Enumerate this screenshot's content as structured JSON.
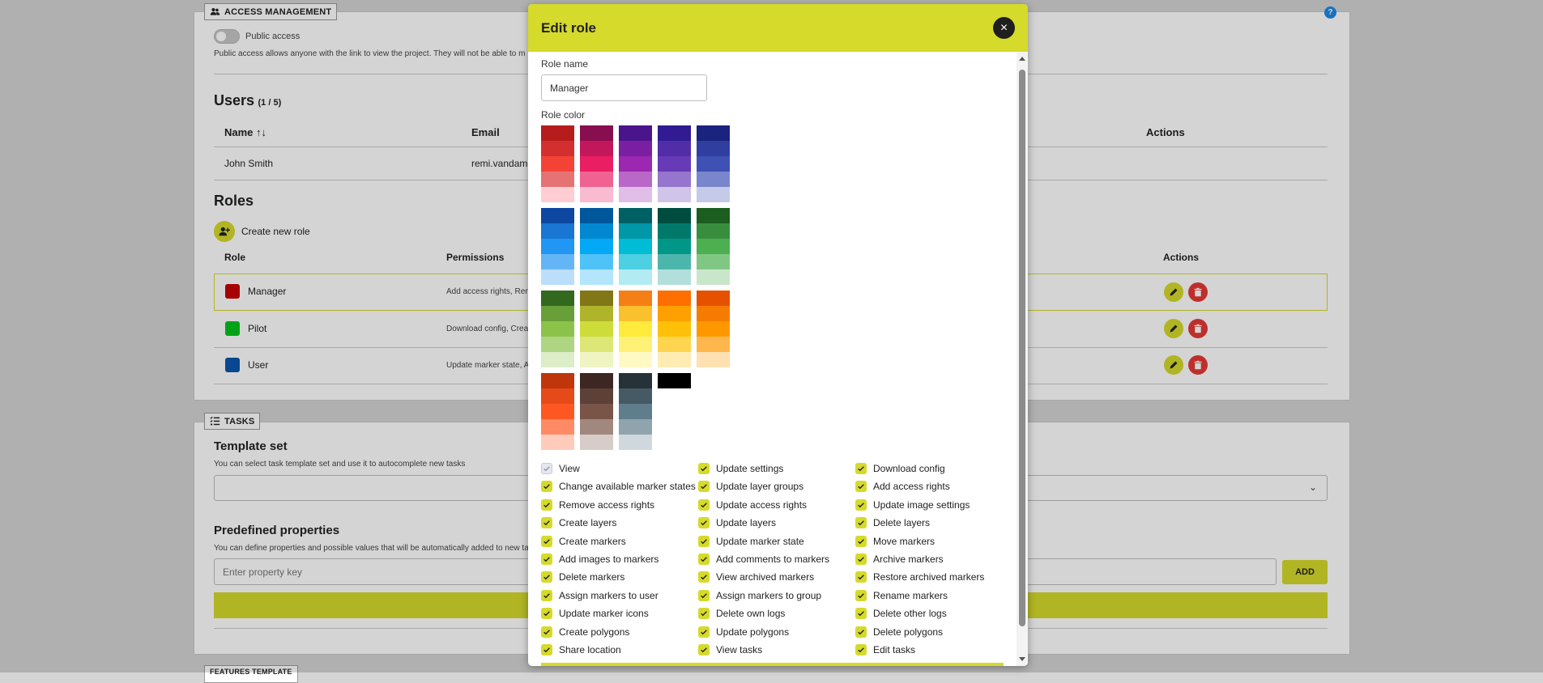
{
  "access": {
    "legend": "ACCESS MANAGEMENT",
    "public_label": "Public access",
    "public_desc": "Public access allows anyone with the link to view the project. They will not be able to m",
    "help": "?"
  },
  "users": {
    "title": "Users",
    "count": "(1 / 5)",
    "col_name": "Name",
    "col_email": "Email",
    "col_actions": "Actions",
    "rows": [
      {
        "name": "John Smith",
        "email": "remi.vandame"
      }
    ]
  },
  "roles": {
    "title": "Roles",
    "create": "Create new role",
    "col_role": "Role",
    "col_permissions": "Permissions",
    "col_actions": "Actions",
    "rows": [
      {
        "name": "Manager",
        "perms": "Add access rights, Remo",
        "color": "#c90000"
      },
      {
        "name": "Pilot",
        "perms": "Download config, Create",
        "color": "#00c31e"
      },
      {
        "name": "User",
        "perms": "Update marker state, Add",
        "color": "#0b56ae"
      }
    ]
  },
  "tasks": {
    "legend": "TASKS",
    "template_title": "Template set",
    "template_desc": "You can select task template set and use it to autocomplete new tasks",
    "predef_title": "Predefined properties",
    "predef_desc": "You can define properties and possible values that will be automatically added to new ta",
    "key_placeholder": "Enter property key",
    "add_label": "ADD"
  },
  "next_legend": "FEATURES TEMPLATE",
  "modal": {
    "title": "Edit role",
    "close": "×",
    "role_name_label": "Role name",
    "role_name_value": "Manager",
    "role_color_label": "Role color",
    "palette": [
      [
        "#b71c1c",
        "#d32f2f",
        "#f44336",
        "#e57373",
        "#ffcdd2"
      ],
      [
        "#880e4f",
        "#c2185b",
        "#e91e63",
        "#f06292",
        "#f8bbd0"
      ],
      [
        "#4a148c",
        "#7b1fa2",
        "#9c27b0",
        "#ba68c8",
        "#e1bee7"
      ],
      [
        "#311b92",
        "#512da8",
        "#673ab7",
        "#9575cd",
        "#d1c4e9"
      ],
      [
        "#1a237e",
        "#303f9f",
        "#3f51b5",
        "#7986cb",
        "#c5cae9"
      ],
      [
        "#0d47a1",
        "#1976d2",
        "#2196f3",
        "#64b5f6",
        "#bbdefb"
      ],
      [
        "#01579b",
        "#0288d1",
        "#03a9f4",
        "#4fc3f7",
        "#b3e5fc"
      ],
      [
        "#006064",
        "#0097a7",
        "#00bcd4",
        "#4dd0e1",
        "#b2ebf2"
      ],
      [
        "#004d40",
        "#00796b",
        "#009688",
        "#4db6ac",
        "#b2dfdb"
      ],
      [
        "#1b5e20",
        "#388e3c",
        "#4caf50",
        "#81c784",
        "#c8e6c9"
      ],
      [
        "#33691e",
        "#689f38",
        "#8bc34a",
        "#aed581",
        "#dcedc8"
      ],
      [
        "#827717",
        "#afb42b",
        "#cddc39",
        "#dce775",
        "#f0f4c3"
      ],
      [
        "#f57f17",
        "#fbc02d",
        "#ffeb3b",
        "#fff176",
        "#fff9c4"
      ],
      [
        "#ff6f00",
        "#ffa000",
        "#ffc107",
        "#ffd54f",
        "#ffecb3"
      ],
      [
        "#e65100",
        "#f57c00",
        "#ff9800",
        "#ffb74d",
        "#ffe0b2"
      ],
      [
        "#bf360c",
        "#e64a19",
        "#ff5722",
        "#ff8a65",
        "#ffccbc"
      ],
      [
        "#3e2723",
        "#5d4037",
        "#795548",
        "#a1887f",
        "#d7ccc8"
      ],
      [
        "#263238",
        "#455a64",
        "#607d8b",
        "#90a4ae",
        "#cfd8dc"
      ],
      [
        "#000000"
      ]
    ],
    "permissions": [
      {
        "label": "View",
        "disabled": true
      },
      {
        "label": "Update settings"
      },
      {
        "label": "Download config"
      },
      {
        "label": "Change available marker states"
      },
      {
        "label": "Update layer groups"
      },
      {
        "label": "Add access rights"
      },
      {
        "label": "Remove access rights"
      },
      {
        "label": "Update access rights"
      },
      {
        "label": "Update image settings"
      },
      {
        "label": "Create layers"
      },
      {
        "label": "Update layers"
      },
      {
        "label": "Delete layers"
      },
      {
        "label": "Create markers"
      },
      {
        "label": "Update marker state"
      },
      {
        "label": "Move markers"
      },
      {
        "label": "Add images to markers"
      },
      {
        "label": "Add comments to markers"
      },
      {
        "label": "Archive markers"
      },
      {
        "label": "Delete markers"
      },
      {
        "label": "View archived markers"
      },
      {
        "label": "Restore archived markers"
      },
      {
        "label": "Assign markers to user"
      },
      {
        "label": "Assign markers to group"
      },
      {
        "label": "Rename markers"
      },
      {
        "label": "Update marker icons"
      },
      {
        "label": "Delete own logs"
      },
      {
        "label": "Delete other logs"
      },
      {
        "label": "Create polygons"
      },
      {
        "label": "Update polygons"
      },
      {
        "label": "Delete polygons"
      },
      {
        "label": "Share location"
      },
      {
        "label": "View tasks"
      },
      {
        "label": "Edit tasks"
      }
    ]
  },
  "colors": {
    "accent": "#d5da2b",
    "danger": "#e53935"
  }
}
